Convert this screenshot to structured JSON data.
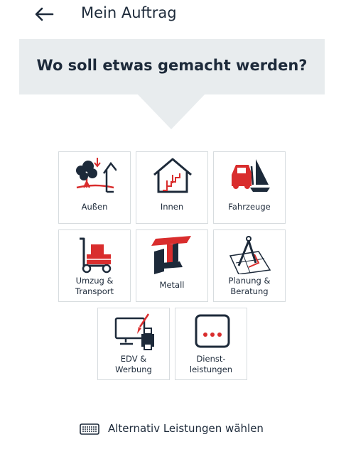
{
  "header": {
    "title": "Mein Auftrag",
    "back_icon": "arrow-left-icon"
  },
  "banner": {
    "question": "Wo soll etwas gemacht werden?"
  },
  "categories": [
    {
      "label": "Außen",
      "icon": "outdoor-tree-house-icon"
    },
    {
      "label": "Innen",
      "icon": "house-interior-stairs-icon"
    },
    {
      "label": "Fahrzeuge",
      "icon": "car-boat-icon"
    },
    {
      "label": "Umzug &\nTransport",
      "icon": "hand-truck-boxes-icon"
    },
    {
      "label": "Metall",
      "icon": "steel-beam-icon"
    },
    {
      "label": "Planung &\nBeratung",
      "icon": "compass-blueprint-icon"
    },
    {
      "label": "EDV &\nWerbung",
      "icon": "monitor-printer-icon"
    },
    {
      "label": "Dienst-\nleistungen",
      "icon": "more-dots-icon"
    }
  ],
  "footer": {
    "alternative_label": "Alternativ Leistungen wählen",
    "icon": "keyboard-icon"
  },
  "colors": {
    "accent": "#d92d2d",
    "ink": "#1d2a3a",
    "banner": "#e8ecee",
    "border": "#d7dcdf"
  }
}
